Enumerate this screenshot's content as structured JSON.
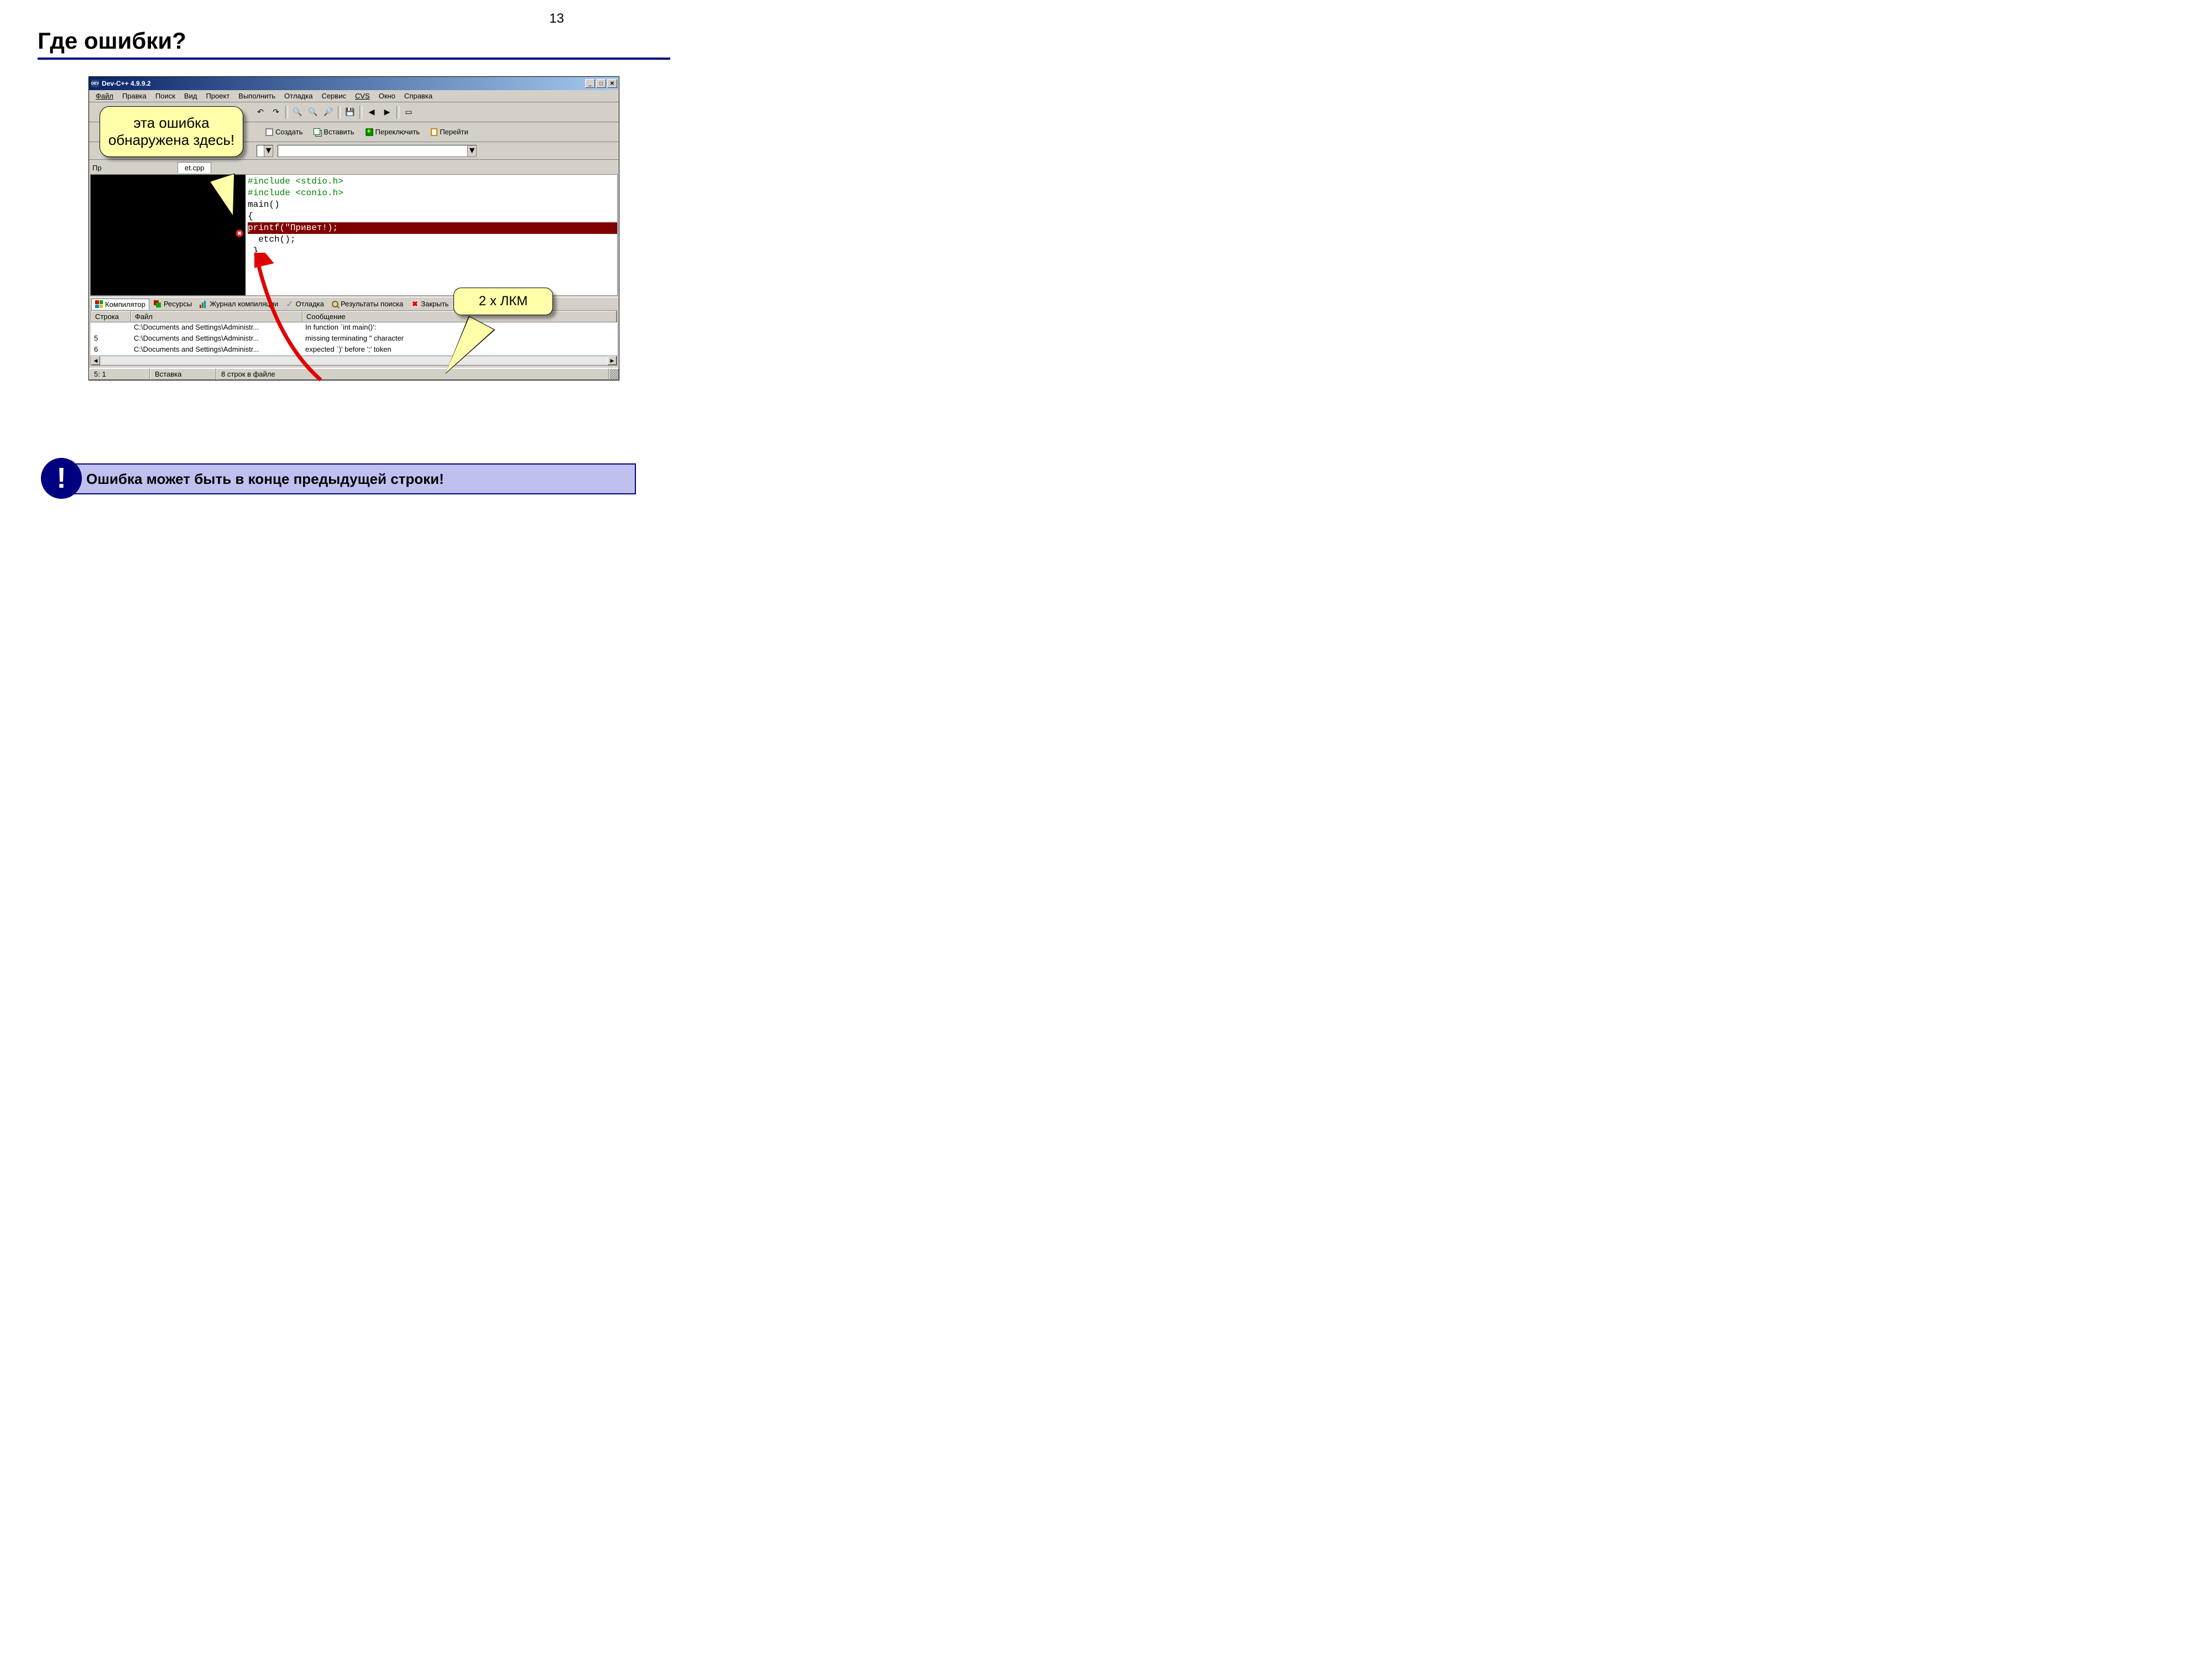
{
  "page": {
    "number": "13",
    "title": "Где ошибки?"
  },
  "window": {
    "title": "Dev-C++ 4.9.9.2",
    "app_icon_text": "DEV"
  },
  "menu": {
    "file": "Файл",
    "edit": "Правка",
    "search": "Поиск",
    "view": "Вид",
    "project": "Проект",
    "run": "Выполнить",
    "debug": "Отладка",
    "service": "Сервис",
    "cvs": "CVS",
    "window": "Окно",
    "help": "Справка"
  },
  "toolbar_btns": {
    "create": "Создать",
    "insert": "Вставить",
    "switch": "Переключить",
    "goto": "Перейти"
  },
  "tabs": {
    "left_label": "Пр",
    "file_tab": "et.cpp"
  },
  "code": {
    "l1a": "#include ",
    "l1b": "<stdio.h>",
    "l2a": "#include ",
    "l2b": "<conio.h>",
    "l3": "main()",
    "l4": "{",
    "l5": "printf(\"Привет!);",
    "l6": "etch();",
    "l7": "}",
    "err_dot": "✖"
  },
  "bottom_tabs": {
    "compiler": "Компилятор",
    "resources": "Ресурсы",
    "log": "Журнал компиляции",
    "debug": "Отладка",
    "results": "Результаты поиска",
    "close": "Закрыть"
  },
  "grid": {
    "h_line": "Строка",
    "h_file": "Файл",
    "h_msg": "Сообщение",
    "rows": [
      {
        "line": "",
        "file": "C:\\Documents and Settings\\Administr...",
        "msg": "In function `int main()':"
      },
      {
        "line": "5",
        "file": "C:\\Documents and Settings\\Administr...",
        "msg": "missing terminating \" character"
      },
      {
        "line": "6",
        "file": "C:\\Documents and Settings\\Administr...",
        "msg": "expected `)' before ';' token"
      }
    ]
  },
  "status": {
    "pos": "5: 1",
    "mode": "Вставка",
    "lines": "8 строк в файле"
  },
  "callout1": "эта ошибка обнаружена здесь!",
  "callout2": "2 х ЛКМ",
  "note": {
    "icon": "!",
    "text": "Ошибка может быть в конце предыдущей строки!"
  }
}
